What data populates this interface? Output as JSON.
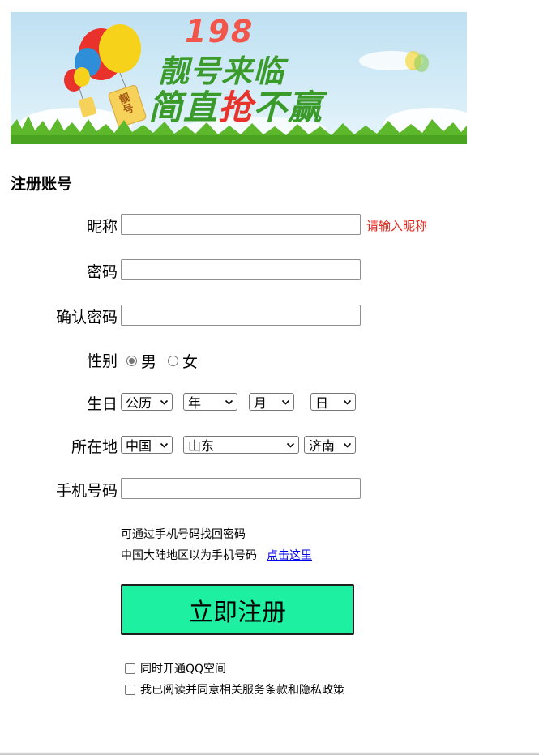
{
  "banner": {
    "number": "198",
    "line1": "靓号来临",
    "line2_a": "简直",
    "line2_b": "抢",
    "line2_c": "不赢",
    "tag": "靓号",
    "colors": {
      "number": "#f2564b",
      "slogan": "#3a9a2a",
      "highlight": "#e8332a",
      "grass": "#5db82c"
    }
  },
  "heading": "注册账号",
  "form": {
    "nickname": {
      "label": "昵称",
      "value": "",
      "hint": "请输入昵称"
    },
    "password": {
      "label": "密码",
      "value": ""
    },
    "confirm": {
      "label": "确认密码",
      "value": ""
    },
    "gender": {
      "label": "性别",
      "options": [
        "男",
        "女"
      ],
      "selected": "男"
    },
    "birthday": {
      "label": "生日",
      "calendar": "公历",
      "year": "年",
      "month": "月",
      "day": "日"
    },
    "location": {
      "label": "所在地",
      "country": "中国",
      "province": "山东",
      "city": "济南"
    },
    "phone": {
      "label": "手机号码",
      "value": ""
    },
    "phone_info_1": "可通过手机号码找回密码",
    "phone_info_2": "中国大陆地区以为手机号码",
    "phone_link": "点击这里",
    "submit": "立即注册",
    "checkbox_qq": "同时开通QQ空间",
    "checkbox_terms": "我已阅读并同意相关服务条款和隐私政策"
  },
  "colors": {
    "hint": "#e2231a",
    "submit_bg": "#1ef0a2",
    "link": "#0000ee"
  }
}
